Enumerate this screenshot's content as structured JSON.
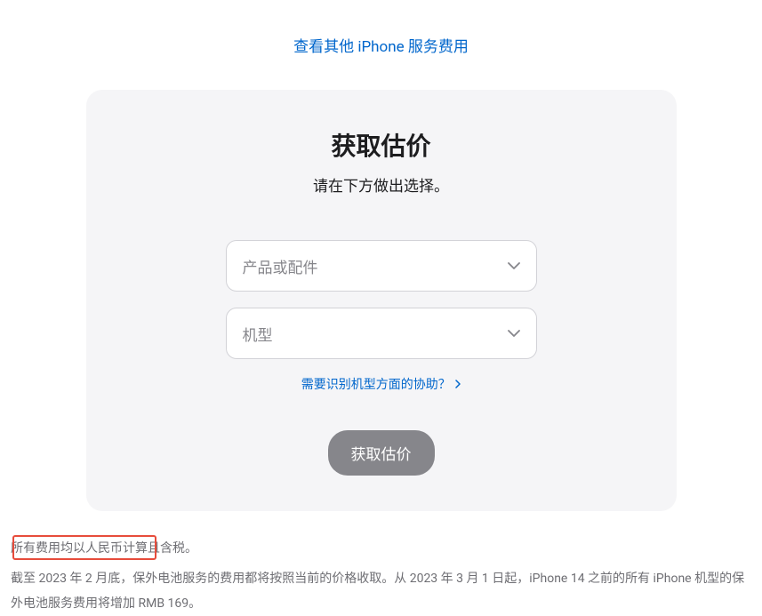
{
  "topLink": {
    "label": "查看其他 iPhone 服务费用"
  },
  "card": {
    "title": "获取估价",
    "subtitle": "请在下方做出选择。",
    "select1": {
      "placeholder": "产品或配件"
    },
    "select2": {
      "placeholder": "机型"
    },
    "helpLink": {
      "label": "需要识别机型方面的协助？"
    },
    "submitButton": {
      "label": "获取估价"
    }
  },
  "footer": {
    "line1": "所有费用均以人民币计算且含税。",
    "line2": "截至 2023 年 2 月底，保外电池服务的费用都将按照当前的价格收取。从 2023 年 3 月 1 日起，iPhone 14 之前的所有 iPhone 机型的保外电池服务费用将增加 RMB 169。"
  }
}
